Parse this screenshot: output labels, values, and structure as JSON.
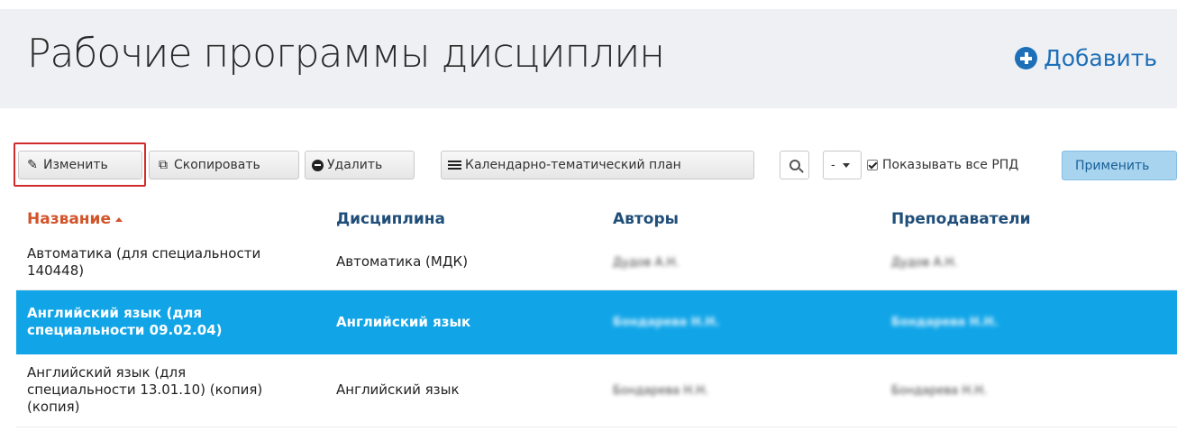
{
  "header": {
    "title": "Рабочие программы дисциплин",
    "add_label": "Добавить"
  },
  "toolbar": {
    "edit_label": "Изменить",
    "copy_label": "Скопировать",
    "delete_label": "Удалить",
    "plan_label": "Календарно-тематический план",
    "select_value": "-",
    "show_all_label": "Показывать все РПД",
    "show_all_checked": true,
    "apply_label": "Применить"
  },
  "table": {
    "columns": [
      "Название",
      "Дисциплина",
      "Авторы",
      "Преподаватели"
    ],
    "sorted_column": "Название",
    "rows": [
      {
        "name_line1": "Автоматика (для специальности",
        "name_line2": "140448)",
        "name_line3": "",
        "discipline": "Автоматика (МДК)",
        "authors": "Дудов А.Н.",
        "teachers": "Дудов А.Н.",
        "selected": false
      },
      {
        "name_line1": "Английский язык (для",
        "name_line2": "специальности 09.02.04)",
        "name_line3": "",
        "discipline": "Английский язык",
        "authors": "Бондарева Н.Н.",
        "teachers": "Бондарева Н.Н.",
        "selected": true
      },
      {
        "name_line1": "Английский язык (для",
        "name_line2": "специальности 13.01.10) (копия)",
        "name_line3": "(копия)",
        "discipline": "Английский язык",
        "authors": "Бондарева Н.Н.",
        "teachers": "Бондарева Н.Н.",
        "selected": false
      }
    ]
  },
  "colors": {
    "accent": "#1d6fb8",
    "selected_row": "#11a5e8",
    "sorted_header": "#d2542a",
    "highlight_outline": "#d22b2b"
  }
}
